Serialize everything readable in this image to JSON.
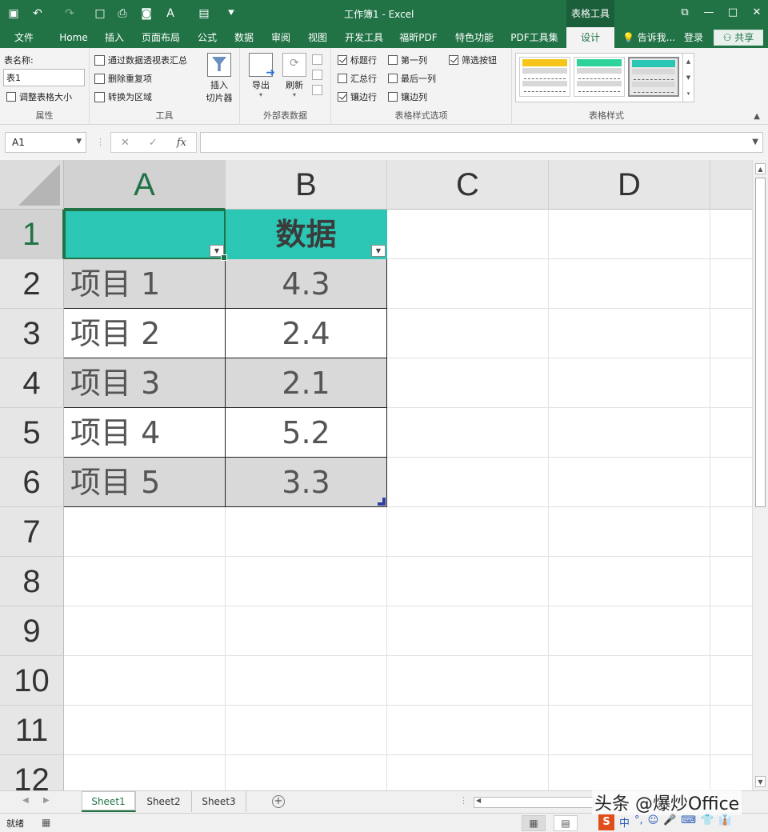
{
  "titlebar": {
    "title": "工作簿1 - Excel",
    "context_tab": "表格工具",
    "quick_access": [
      {
        "name": "save-icon",
        "glyph": "▣"
      },
      {
        "name": "undo-icon",
        "glyph": "↶"
      },
      {
        "name": "redo-icon",
        "glyph": "↷"
      },
      {
        "name": "new-doc-icon",
        "glyph": "□"
      },
      {
        "name": "print-preview-icon",
        "glyph": "⎙"
      },
      {
        "name": "camera-icon",
        "glyph": "◙"
      },
      {
        "name": "font-color-icon",
        "glyph": "A"
      },
      {
        "name": "paste-icon",
        "glyph": "▤"
      },
      {
        "name": "customize-icon",
        "glyph": "⯆"
      }
    ],
    "window_controls": [
      {
        "name": "ribbon-display-icon",
        "glyph": "⧉"
      },
      {
        "name": "minimize-icon",
        "glyph": "—"
      },
      {
        "name": "maximize-icon",
        "glyph": "□"
      },
      {
        "name": "close-icon",
        "glyph": "✕"
      }
    ]
  },
  "tabs": {
    "items": [
      "文件",
      "Home",
      "插入",
      "页面布局",
      "公式",
      "数据",
      "审阅",
      "视图",
      "开发工具",
      "福昕PDF",
      "特色功能",
      "PDF工具集",
      "设计"
    ],
    "active": "设计",
    "tell_me": "告诉我...",
    "login": "登录",
    "share": "共享"
  },
  "ribbon": {
    "properties": {
      "label": "属性",
      "table_name_label": "表名称:",
      "table_name_value": "表1",
      "resize_label": "调整表格大小"
    },
    "tools": {
      "label": "工具",
      "pivot": "通过数据透视表汇总",
      "remove_dup": "删除重复项",
      "convert": "转换为区域",
      "slicer_line1": "插入",
      "slicer_line2": "切片器"
    },
    "external": {
      "label": "外部表数据",
      "export": "导出",
      "refresh": "刷新"
    },
    "options": {
      "label": "表格样式选项",
      "header_row": {
        "text": "标题行",
        "checked": true
      },
      "total_row": {
        "text": "汇总行",
        "checked": false
      },
      "banded_rows": {
        "text": "镶边行",
        "checked": true
      },
      "first_col": {
        "text": "第一列",
        "checked": false
      },
      "last_col": {
        "text": "最后一列",
        "checked": false
      },
      "banded_cols": {
        "text": "镶边列",
        "checked": false
      },
      "filter_btn": {
        "text": "筛选按钮",
        "checked": true
      }
    },
    "styles": {
      "label": "表格样式",
      "swatches": [
        "#f5c518",
        "#2ed39a",
        "#2bc7b4"
      ],
      "selected_index": 2
    }
  },
  "formula_bar": {
    "name_box": "A1",
    "cancel": "✕",
    "enter": "✓",
    "fx": "fx",
    "value": ""
  },
  "sheet": {
    "columns": [
      "A",
      "B",
      "C",
      "D"
    ],
    "rows": [
      "1",
      "2",
      "3",
      "4",
      "5",
      "6",
      "7",
      "8",
      "9",
      "10",
      "11",
      "12"
    ],
    "header": [
      "",
      "数据"
    ],
    "data": [
      [
        "项目 1",
        "4.3"
      ],
      [
        "项目 2",
        "2.4"
      ],
      [
        "项目 3",
        "2.1"
      ],
      [
        "项目 4",
        "5.2"
      ],
      [
        "项目 5",
        "3.3"
      ]
    ],
    "header_color": "#2bc7b4",
    "band_color": "#d9d9d9",
    "selected_cell": "A1"
  },
  "sheet_tabs": {
    "items": [
      "Sheet1",
      "Sheet2",
      "Sheet3"
    ],
    "active": "Sheet1"
  },
  "status": {
    "text": "就绪",
    "watermark": "头条 @爆炒Office",
    "ime": [
      "S",
      "中",
      "°,",
      "☺",
      "🎤",
      "⌨",
      "👕",
      "👔"
    ]
  },
  "colors": {
    "excel_green": "#217346"
  }
}
